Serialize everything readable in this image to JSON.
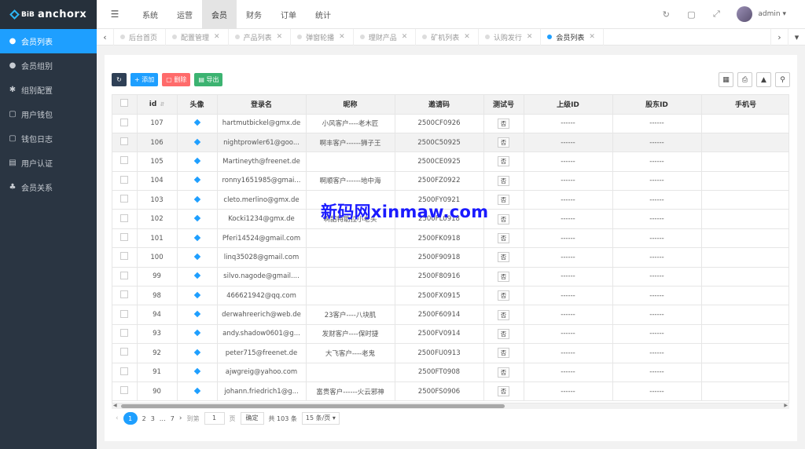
{
  "app": {
    "logo_mark": "BiB",
    "logo_text": "anchorx"
  },
  "sidebar": {
    "items": [
      {
        "label": "会员列表",
        "icon": "user-icon",
        "active": true
      },
      {
        "label": "会员组别",
        "icon": "user-group-icon",
        "active": false
      },
      {
        "label": "组别配置",
        "icon": "gear-icon",
        "active": false
      },
      {
        "label": "用户钱包",
        "icon": "wallet-icon",
        "active": false
      },
      {
        "label": "钱包日志",
        "icon": "list-icon",
        "active": false
      },
      {
        "label": "用户认证",
        "icon": "id-card-icon",
        "active": false
      },
      {
        "label": "会员关系",
        "icon": "relation-icon",
        "active": false
      }
    ]
  },
  "topnav": {
    "items": [
      "系统",
      "运营",
      "会员",
      "财务",
      "订单",
      "统计"
    ],
    "active_index": 2,
    "user": "admin"
  },
  "tabs": {
    "items": [
      {
        "label": "后台首页",
        "closable": false,
        "active": false
      },
      {
        "label": "配置管理",
        "closable": true,
        "active": false
      },
      {
        "label": "产品列表",
        "closable": true,
        "active": false
      },
      {
        "label": "弹窗轮播",
        "closable": true,
        "active": false
      },
      {
        "label": "理财产品",
        "closable": true,
        "active": false
      },
      {
        "label": "矿机列表",
        "closable": true,
        "active": false
      },
      {
        "label": "认购发行",
        "closable": true,
        "active": false
      },
      {
        "label": "会员列表",
        "closable": true,
        "active": true
      }
    ]
  },
  "toolbar": {
    "add": "添加",
    "delete": "删除",
    "export": "导出"
  },
  "table": {
    "columns": [
      "id",
      "头像",
      "登录名",
      "昵称",
      "邀请码",
      "测试号",
      "上级ID",
      "股东ID",
      "手机号"
    ],
    "rows": [
      {
        "id": "107",
        "login": "hartmutbickel@gmx.de",
        "nick": "小风客户----老木匠",
        "code": "2500CF0926",
        "test": "否",
        "parent": "------",
        "holder": "------",
        "phone": ""
      },
      {
        "id": "106",
        "login": "nightprowler61@goo...",
        "nick": "啊丰客户------狮子王",
        "code": "2500C50925",
        "test": "否",
        "parent": "------",
        "holder": "------",
        "phone": ""
      },
      {
        "id": "105",
        "login": "Martineyth@freenet.de",
        "nick": "",
        "code": "2500CE0925",
        "test": "否",
        "parent": "------",
        "holder": "------",
        "phone": ""
      },
      {
        "id": "104",
        "login": "ronny1651985@gmai...",
        "nick": "啊顺客户------地中海",
        "code": "2500FZ0922",
        "test": "否",
        "parent": "------",
        "holder": "------",
        "phone": ""
      },
      {
        "id": "103",
        "login": "cleto.merlino@gmx.de",
        "nick": "",
        "code": "2500FY0921",
        "test": "否",
        "parent": "------",
        "holder": "------",
        "phone": ""
      },
      {
        "id": "102",
        "login": "Kocki1234@gmx.de",
        "nick": "啊韶特助拉小老头",
        "code": "2500FL0918",
        "test": "否",
        "parent": "------",
        "holder": "------",
        "phone": ""
      },
      {
        "id": "101",
        "login": "Pferi14524@gmail.com",
        "nick": "",
        "code": "2500FK0918",
        "test": "否",
        "parent": "------",
        "holder": "------",
        "phone": ""
      },
      {
        "id": "100",
        "login": "linq35028@gmail.com",
        "nick": "",
        "code": "2500F90918",
        "test": "否",
        "parent": "------",
        "holder": "------",
        "phone": ""
      },
      {
        "id": "99",
        "login": "silvo.nagode@gmail....",
        "nick": "",
        "code": "2500F80916",
        "test": "否",
        "parent": "------",
        "holder": "------",
        "phone": ""
      },
      {
        "id": "98",
        "login": "466621942@qq.com",
        "nick": "",
        "code": "2500FX0915",
        "test": "否",
        "parent": "------",
        "holder": "------",
        "phone": ""
      },
      {
        "id": "94",
        "login": "derwahreerich@web.de",
        "nick": "23客户----八块肌",
        "code": "2500F60914",
        "test": "否",
        "parent": "------",
        "holder": "------",
        "phone": ""
      },
      {
        "id": "93",
        "login": "andy.shadow0601@g...",
        "nick": "发财客户----保时捷",
        "code": "2500FV0914",
        "test": "否",
        "parent": "------",
        "holder": "------",
        "phone": ""
      },
      {
        "id": "92",
        "login": "peter715@freenet.de",
        "nick": "大飞客户----老鬼",
        "code": "2500FU0913",
        "test": "否",
        "parent": "------",
        "holder": "------",
        "phone": ""
      },
      {
        "id": "91",
        "login": "ajwgreig@yahoo.com",
        "nick": "",
        "code": "2500FT0908",
        "test": "否",
        "parent": "------",
        "holder": "------",
        "phone": ""
      },
      {
        "id": "90",
        "login": "johann.friedrich1@g...",
        "nick": "富贵客户------火云邪神",
        "code": "2500FS0906",
        "test": "否",
        "parent": "------",
        "holder": "------",
        "phone": ""
      }
    ]
  },
  "pagination": {
    "pages": [
      "1",
      "2",
      "3",
      "…",
      "7"
    ],
    "current": "1",
    "goto_label": "到第",
    "goto_value": "1",
    "page_unit": "页",
    "confirm": "确定",
    "total": "共 103 条",
    "per_page": "15 条/页"
  },
  "watermark": "新码网xinmaw.com"
}
